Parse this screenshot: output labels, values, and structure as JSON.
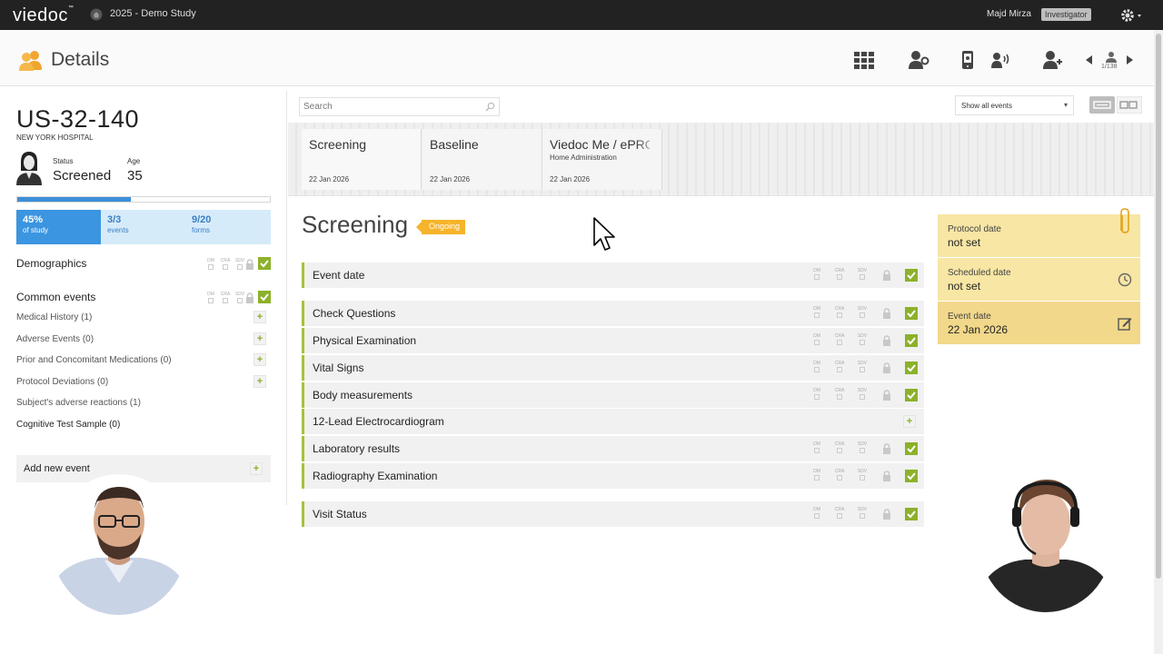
{
  "topbar": {
    "logo": "viedoc",
    "logo_tm": "™",
    "study": "2025 - Demo Study",
    "user": "Majd Mirza",
    "role": "Investigator"
  },
  "header": {
    "title": "Details",
    "pager": "1/138"
  },
  "subject": {
    "id": "US-32-140",
    "site": "NEW YORK HOSPITAL",
    "status_label": "Status",
    "status": "Screened",
    "age_label": "Age",
    "age": "35",
    "progress_fraction": 0.45,
    "stats": [
      {
        "big": "45%",
        "small": "of study"
      },
      {
        "big": "3/3",
        "small": "events"
      },
      {
        "big": "9/20",
        "small": "forms"
      }
    ]
  },
  "mini_cols": [
    "DM",
    "CRA",
    "SDV"
  ],
  "left_sections": {
    "demographics": "Demographics",
    "common_events": "Common events",
    "items": [
      {
        "label": "Medical History (1)",
        "plus": true
      },
      {
        "label": "Adverse Events (0)",
        "plus": true
      },
      {
        "label": "Prior and Concomitant Medications (0)",
        "plus": true
      },
      {
        "label": "Protocol Deviations (0)",
        "plus": true
      },
      {
        "label": "Subject's adverse reactions (1)",
        "plus": false
      },
      {
        "label": "Cognitive Test Sample (0)",
        "plus": false
      }
    ],
    "add_event": "Add new event",
    "plus": "+"
  },
  "main": {
    "search_placeholder": "Search",
    "events_filter": "Show all events",
    "caret": "▾",
    "events": [
      {
        "name": "Screening",
        "sub": "",
        "date": "22 Jan 2026"
      },
      {
        "name": "Baseline",
        "sub": "",
        "date": "22 Jan 2026"
      },
      {
        "name": "Viedoc Me / ePRO",
        "sub": "Home Administration",
        "date": "22 Jan 2026"
      }
    ],
    "visit_title": "Screening",
    "visit_badge": "Ongoing",
    "forms": [
      {
        "label": "Event date",
        "state": "done"
      },
      {
        "label": "Check Questions",
        "state": "done"
      },
      {
        "label": "Physical Examination",
        "state": "done"
      },
      {
        "label": "Vital Signs",
        "state": "done"
      },
      {
        "label": "Body measurements",
        "state": "done"
      },
      {
        "label": "12-Lead Electrocardiogram",
        "state": "add"
      },
      {
        "label": "Laboratory results",
        "state": "done"
      },
      {
        "label": "Radiography Examination",
        "state": "done"
      },
      {
        "label": "Visit Status",
        "state": "done"
      }
    ]
  },
  "dates": {
    "protocol_label": "Protocol date",
    "protocol_value": "not set",
    "scheduled_label": "Scheduled date",
    "scheduled_value": "not set",
    "event_label": "Event date",
    "event_value": "22 Jan 2026"
  },
  "colors": {
    "topbar": "#222222",
    "accent_blue": "#3c95e0",
    "check_green": "#8cb12a",
    "ongoing": "#f5b42a",
    "date_panel": "#f7e6a4"
  }
}
